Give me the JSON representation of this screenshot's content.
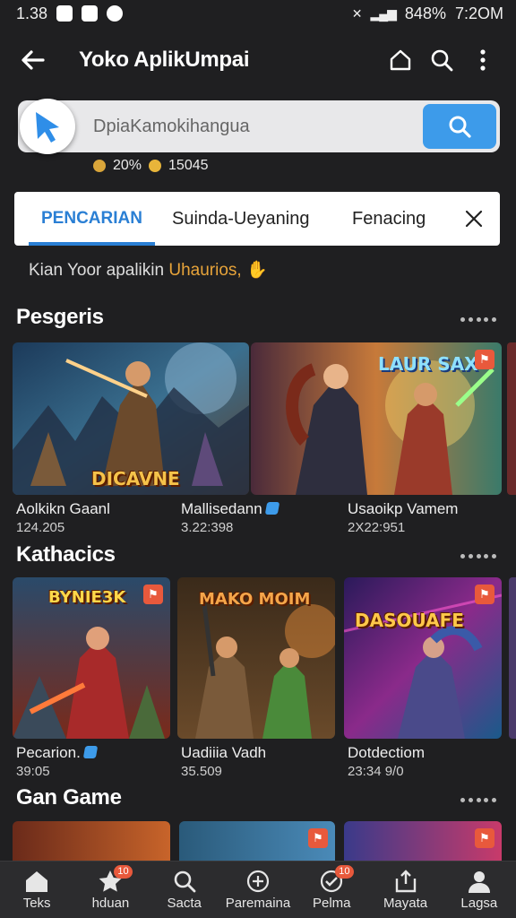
{
  "status_bar": {
    "time": "1.38",
    "battery": "848%",
    "clock": "7:2OM"
  },
  "app_bar": {
    "title": "Yoko AplikUmpai"
  },
  "search": {
    "placeholder": "DpiaKamokihangua"
  },
  "stats": {
    "percent": "20%",
    "count": "15045"
  },
  "tabs": [
    {
      "label": "PENCARIAN",
      "active": true
    },
    {
      "label": "Suinda-Ueyaning",
      "active": false
    },
    {
      "label": "Fenacing",
      "active": false
    }
  ],
  "hint": {
    "text": "Kian Yoor apalikin ",
    "accent": "Uhaurios, "
  },
  "sections": [
    {
      "title": "Pesgeris",
      "cards": [
        {
          "name": "Aolkikn Gaanl",
          "meta": "124.205",
          "thumb_title": "DICAVNE",
          "verified": false
        },
        {
          "name": "Mallisedann",
          "meta": "3.22:398",
          "thumb_title": "LAUR SAX",
          "verified": true
        },
        {
          "name": "Usaoikp Vamem",
          "meta": "2X22:951",
          "thumb_title": "",
          "verified": false
        }
      ]
    },
    {
      "title": "Kathacics",
      "cards": [
        {
          "name": "Pecarion.",
          "meta": "39:05",
          "thumb_title": "BYNIE3K",
          "verified": true
        },
        {
          "name": "Uadiiia Vadh",
          "meta": "35.509",
          "thumb_title": "MAKO MOIM",
          "verified": false
        },
        {
          "name": "Dotdectiom",
          "meta": "23:34 9/0",
          "thumb_title": "DASOUAFE",
          "verified": false
        }
      ]
    },
    {
      "title": "Gan Game"
    }
  ],
  "bottom_nav": [
    {
      "label": "Teks",
      "icon": "home-icon",
      "badge": ""
    },
    {
      "label": "hduan",
      "icon": "star-icon",
      "badge": "10"
    },
    {
      "label": "Sacta",
      "icon": "search-icon",
      "badge": ""
    },
    {
      "label": "Paremaina",
      "icon": "plus-circle-icon",
      "badge": ""
    },
    {
      "label": "Pelma",
      "icon": "check-circle-icon",
      "badge": "10"
    },
    {
      "label": "Mayata",
      "icon": "share-icon",
      "badge": ""
    },
    {
      "label": "Lagsa",
      "icon": "person-icon",
      "badge": ""
    }
  ],
  "colors": {
    "accent": "#3d9bea",
    "badge": "#e8593c",
    "background": "#1f1f21"
  }
}
